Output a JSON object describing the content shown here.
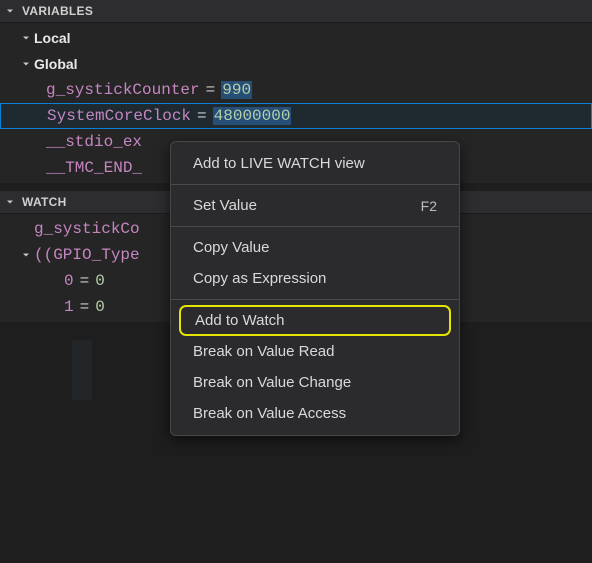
{
  "variablesSection": {
    "title": "VARIABLES",
    "scopes": {
      "local": {
        "label": "Local"
      },
      "global": {
        "label": "Global",
        "items": [
          {
            "name": "g_systickCounter",
            "eq": "=",
            "value": "990"
          },
          {
            "name": "SystemCoreClock",
            "eq": "=",
            "value": "48000000"
          },
          {
            "name": "__stdio_ex"
          },
          {
            "name": "__TMC_END_"
          }
        ]
      }
    }
  },
  "watchSection": {
    "title": "WATCH",
    "items": [
      {
        "name": "g_systickCo"
      },
      {
        "name": "((GPIO_Type",
        "expanded": true,
        "children": [
          {
            "idx": "0",
            "eq": "=",
            "value": "0"
          },
          {
            "idx": "1",
            "eq": "=",
            "value": "0"
          }
        ]
      }
    ]
  },
  "contextMenu": {
    "items": [
      {
        "label": "Add to LIVE WATCH view"
      },
      {
        "label": "Set Value",
        "shortcut": "F2"
      },
      {
        "label": "Copy Value"
      },
      {
        "label": "Copy as Expression"
      },
      {
        "label": "Add to Watch"
      },
      {
        "label": "Break on Value Read"
      },
      {
        "label": "Break on Value Change"
      },
      {
        "label": "Break on Value Access"
      }
    ]
  }
}
